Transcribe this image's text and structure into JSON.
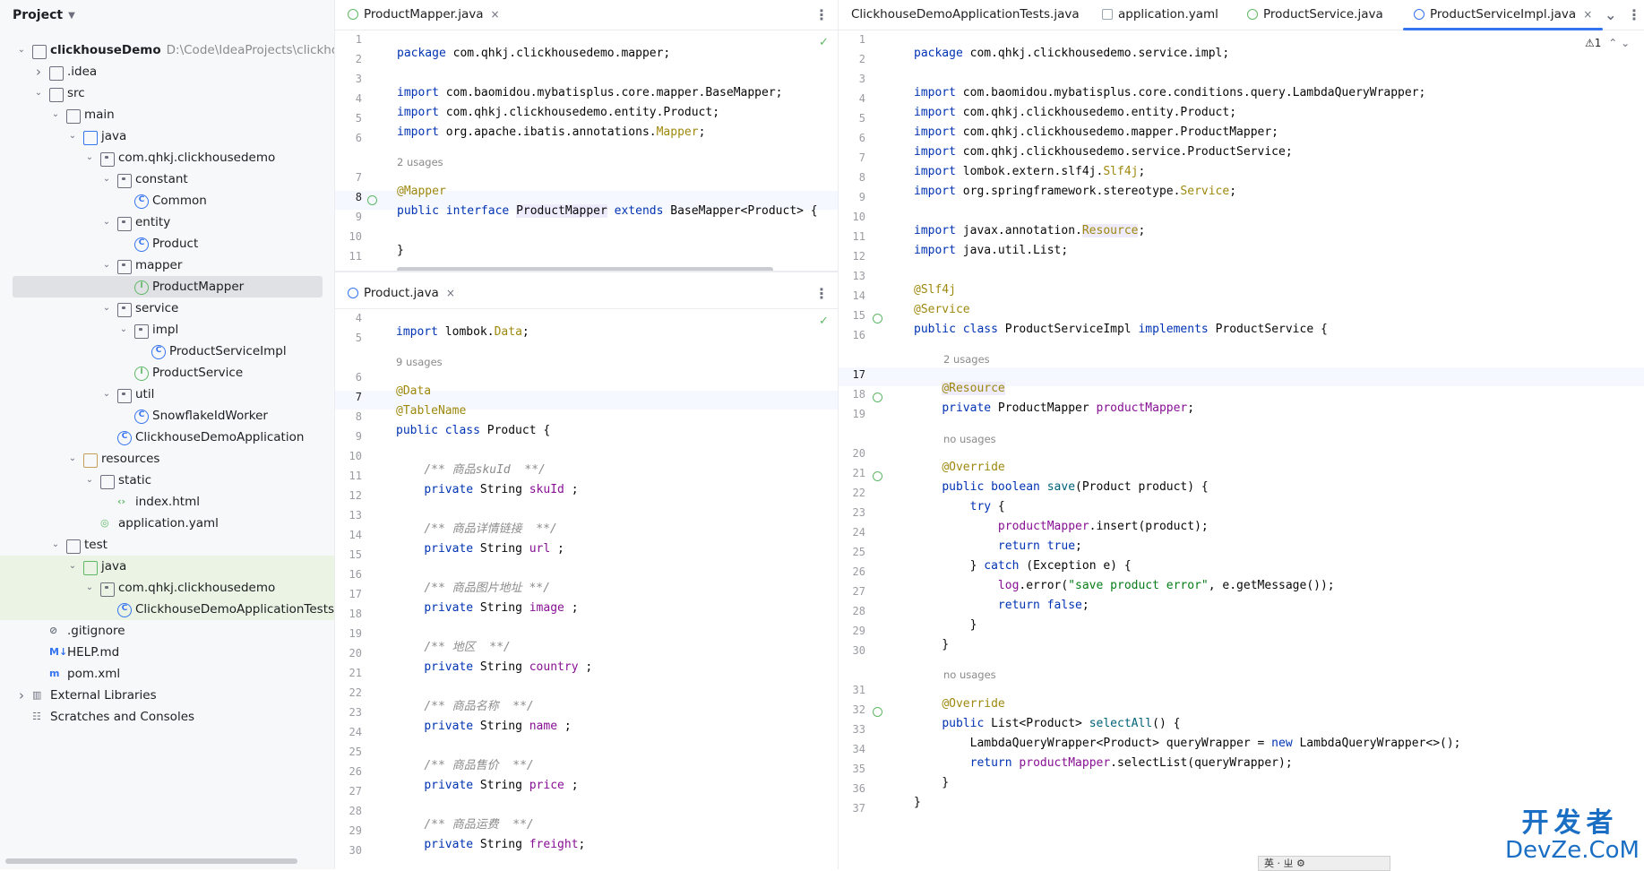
{
  "project_panel": {
    "title": "Project",
    "tree": [
      {
        "depth": 0,
        "arrow": "v",
        "icon": "module",
        "label": "clickhouseDemo",
        "path": "D:\\Code\\IdeaProjects\\clickhouseD"
      },
      {
        "depth": 1,
        "arrow": ">",
        "icon": "folder",
        "label": ".idea"
      },
      {
        "depth": 1,
        "arrow": "v",
        "icon": "folder",
        "label": "src"
      },
      {
        "depth": 2,
        "arrow": "v",
        "icon": "folder",
        "label": "main"
      },
      {
        "depth": 3,
        "arrow": "v",
        "icon": "folder-blue",
        "label": "java"
      },
      {
        "depth": 4,
        "arrow": "v",
        "icon": "package",
        "label": "com.qhkj.clickhousedemo"
      },
      {
        "depth": 5,
        "arrow": "v",
        "icon": "package",
        "label": "constant"
      },
      {
        "depth": 6,
        "arrow": "",
        "icon": "class",
        "label": "Common"
      },
      {
        "depth": 5,
        "arrow": "v",
        "icon": "package",
        "label": "entity"
      },
      {
        "depth": 6,
        "arrow": "",
        "icon": "class",
        "label": "Product"
      },
      {
        "depth": 5,
        "arrow": "v",
        "icon": "package",
        "label": "mapper"
      },
      {
        "depth": 6,
        "arrow": "",
        "icon": "interface",
        "label": "ProductMapper",
        "selected": true
      },
      {
        "depth": 5,
        "arrow": "v",
        "icon": "package",
        "label": "service"
      },
      {
        "depth": 6,
        "arrow": "v",
        "icon": "package",
        "label": "impl"
      },
      {
        "depth": 7,
        "arrow": "",
        "icon": "class",
        "label": "ProductServiceImpl"
      },
      {
        "depth": 6,
        "arrow": "",
        "icon": "interface",
        "label": "ProductService"
      },
      {
        "depth": 5,
        "arrow": "v",
        "icon": "package",
        "label": "util"
      },
      {
        "depth": 6,
        "arrow": "",
        "icon": "class",
        "label": "SnowflakeIdWorker"
      },
      {
        "depth": 5,
        "arrow": "",
        "icon": "class",
        "label": "ClickhouseDemoApplication"
      },
      {
        "depth": 3,
        "arrow": "v",
        "icon": "folder-orange",
        "label": "resources"
      },
      {
        "depth": 4,
        "arrow": "v",
        "icon": "folder",
        "label": "static"
      },
      {
        "depth": 5,
        "arrow": "",
        "icon": "html",
        "label": "index.html"
      },
      {
        "depth": 4,
        "arrow": "",
        "icon": "yaml",
        "label": "application.yaml"
      },
      {
        "depth": 2,
        "arrow": "v",
        "icon": "folder",
        "label": "test"
      },
      {
        "depth": 3,
        "arrow": "v",
        "icon": "folder-green",
        "label": "java",
        "test": true
      },
      {
        "depth": 4,
        "arrow": "v",
        "icon": "package",
        "label": "com.qhkj.clickhousedemo",
        "test": true
      },
      {
        "depth": 5,
        "arrow": "",
        "icon": "class",
        "label": "ClickhouseDemoApplicationTests",
        "test": true
      },
      {
        "depth": 1,
        "arrow": "",
        "icon": "gitignore",
        "label": ".gitignore"
      },
      {
        "depth": 1,
        "arrow": "",
        "icon": "markdown",
        "label": "HELP.md"
      },
      {
        "depth": 1,
        "arrow": "",
        "icon": "maven",
        "label": "pom.xml"
      },
      {
        "depth": 0,
        "arrow": ">",
        "icon": "library",
        "label": "External Libraries"
      },
      {
        "depth": 0,
        "arrow": "",
        "icon": "scratch",
        "label": "Scratches and Consoles"
      }
    ]
  },
  "left_top_editor": {
    "tab": {
      "label": "ProductMapper.java",
      "close": "×"
    },
    "kebab": "⋮",
    "hint_usages": "2 usages"
  },
  "left_bottom_editor": {
    "tab": {
      "label": "Product.java",
      "close": "×"
    },
    "kebab": "⋮",
    "hint_usages": "9 usages"
  },
  "right_editor": {
    "tabs": [
      {
        "label": "ClickhouseDemoApplicationTests.java"
      },
      {
        "label": "application.yaml"
      },
      {
        "label": "ProductService.java"
      },
      {
        "label": "ProductServiceImpl.java",
        "close": "×",
        "active": true
      }
    ],
    "chevron": "⌄",
    "kebab": "⋮",
    "warnings": "⚠1",
    "hints": {
      "h1": "2 usages",
      "h2": "no usages",
      "h3": "no usages"
    }
  },
  "watermark": {
    "line1": "开发者",
    "line2": "DevZe.CoM"
  },
  "ime_bar": "英 · ㄓ ⚙"
}
